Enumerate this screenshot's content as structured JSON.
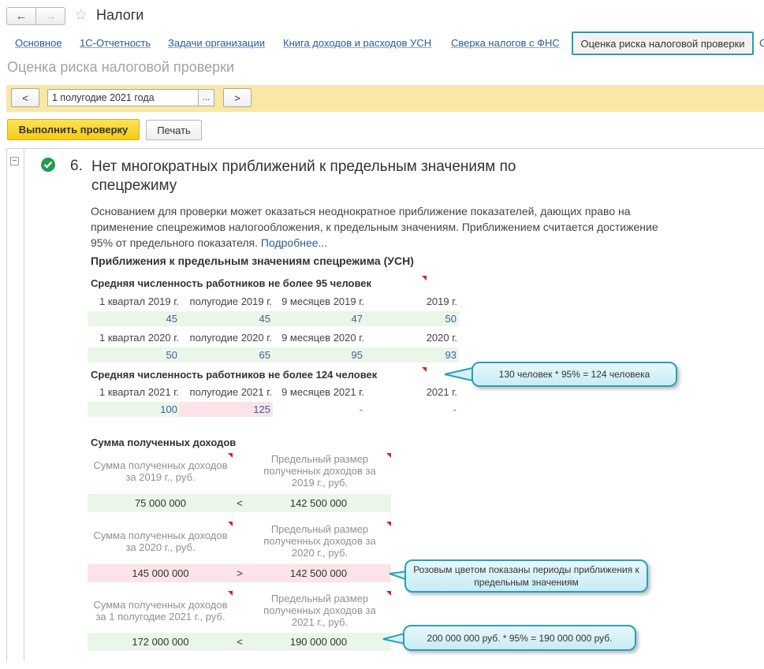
{
  "window": {
    "title": "Налоги",
    "back_glyph": "←",
    "forward_glyph": "→",
    "star_glyph": "☆"
  },
  "tabs": [
    {
      "label": "Основное"
    },
    {
      "label": "1С-Отчетность"
    },
    {
      "label": "Задачи организации"
    },
    {
      "label": "Книга доходов и расходов УСН"
    },
    {
      "label": "Сверка налогов с ФНС"
    },
    {
      "label": "Оценка риска налоговой проверки",
      "active": true
    },
    {
      "label": "С"
    }
  ],
  "page_title": "Оценка риска налоговой проверки",
  "period": {
    "prev": "<",
    "value": "1 полугодие 2021 года",
    "pick": "...",
    "next": ">"
  },
  "actions": {
    "run": "Выполнить проверку",
    "print": "Печать"
  },
  "section": {
    "collapse": "−",
    "number": "6.",
    "title": "Нет многократных приближений к предельным значениям по спецрежиму",
    "desc_text": "Основанием для проверки может оказаться неоднократное приближение показателей, дающих право на применение спецрежимов налогообложения, к предельным значениям. Приближением считается достижение 95% от предельного показателя.",
    "desc_link": "Подробнее...",
    "subheader": "Приближения к предельным значениям спецрежима (УСН)"
  },
  "employees": {
    "group1": "Средняя численность работников не более 95 человек",
    "row1_labels": [
      "1 квартал 2019 г.",
      "полугодие 2019 г.",
      "9 месяцев 2019 г.",
      "2019 г."
    ],
    "row1_values": [
      "45",
      "45",
      "47",
      "50"
    ],
    "row2_labels": [
      "1 квартал 2020 г.",
      "полугодие 2020 г.",
      "9 месяцев 2020 г.",
      "2020 г."
    ],
    "row2_values": [
      "50",
      "65",
      "95",
      "93"
    ],
    "group2": "Средняя численность работников не более 124 человек",
    "row3_labels": [
      "1 квартал 2021 г.",
      "полугодие 2021 г.",
      "9 месяцев 2021 г.",
      "2021 г."
    ],
    "row3_values": [
      "100",
      "125",
      "-",
      "-"
    ]
  },
  "income": {
    "title": "Сумма полученных доходов",
    "blocks": [
      {
        "label_left": "Сумма полученных доходов за 2019 г., руб.",
        "label_right": "Предельный размер полученных доходов за 2019 г., руб.",
        "value": "75 000 000",
        "op": "<",
        "limit": "142 500 000"
      },
      {
        "label_left": "Сумма полученных доходов за 2020 г., руб.",
        "label_right": "Предельный размер полученных доходов за 2020 г., руб.",
        "value": "145 000 000",
        "op": ">",
        "limit": "142 500 000"
      },
      {
        "label_left": "Сумма полученных доходов за 1 полугодие 2021 г., руб.",
        "label_right": "Предельный размер полученных доходов за 2021 г., руб.",
        "value": "172 000 000",
        "op": "<",
        "limit": "190 000 000"
      }
    ]
  },
  "callouts": {
    "c1": "130 человек * 95% = 124 человека",
    "c2": "Розовым цветом показаны периоды приближения к предельным значениям",
    "c3": "200 000 000 руб. * 95% = 190 000 000 руб."
  },
  "colors": {
    "accent_yellow": "#f5cc0f",
    "highlight_green": "#eaf6e8",
    "highlight_pink": "#fbe3e7",
    "callout_border": "#2b9ebb",
    "check_green": "#1f9c51"
  }
}
